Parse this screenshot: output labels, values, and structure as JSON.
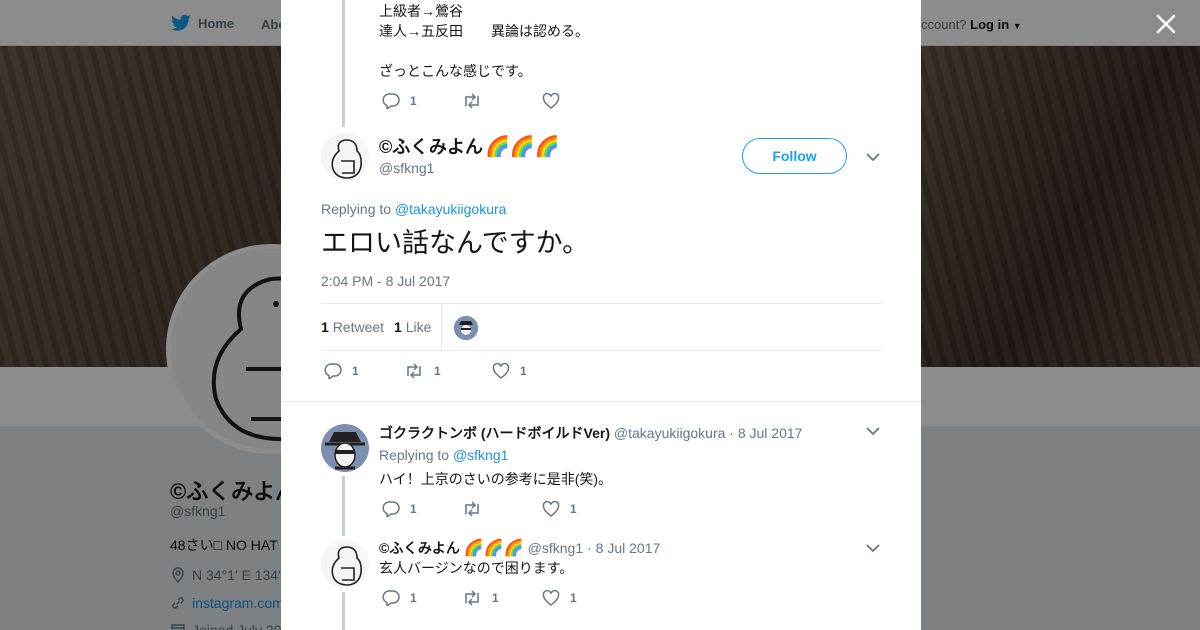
{
  "nav": {
    "home_label": "Home",
    "about_label": "Abo",
    "account_prompt": "ccount?",
    "login_label": "Log in"
  },
  "profile": {
    "name": "©ふくみよん",
    "handle": "@sfkng1",
    "bio": "48さい□ NO HAT",
    "location": "N 34°1′ E 134°",
    "link": "instagram.com",
    "joined": "Joined July 20"
  },
  "prev_tweet": {
    "line1": "上級者→鶯谷",
    "line2": "達人→五反田　　異論は認める。",
    "line3": "ざっとこんな感じです。",
    "reply_count": "1"
  },
  "main_tweet": {
    "author_name": "©ふくみよん",
    "author_emoji": "🌈🌈🌈",
    "author_handle": "@sfkng1",
    "follow_label": "Follow",
    "replying_prefix": "Replying to",
    "replying_to": "@takayukiigokura",
    "text": "エロい話なんですか。",
    "timestamp": "2:04 PM - 8 Jul 2017",
    "retweet_count": "1",
    "retweet_label": "Retweet",
    "like_count": "1",
    "like_label": "Like",
    "reply_count": "1",
    "rt_count": "1",
    "fav_count": "1"
  },
  "replies": [
    {
      "name": "ゴクラクトンボ (ハードボイルドVer)",
      "handle": "@takayukiigokura",
      "date": "· 8 Jul 2017",
      "replying_prefix": "Replying to",
      "replying_to": "@sfkng1",
      "text": "ハイ！上京のさいの参考に是非(笑)。",
      "reply_count": "1",
      "rt_count": "",
      "like_count": "1"
    },
    {
      "name": "©ふくみよん",
      "emoji": "🌈🌈🌈",
      "handle": "@sfkng1",
      "date": "· 8 Jul 2017",
      "text": "玄人バージンなので困ります。",
      "reply_count": "1",
      "rt_count": "1",
      "like_count": "1"
    }
  ],
  "colors": {
    "accent": "#1b95e0",
    "text_secondary": "#657786",
    "thread_line": "#c4cfd6"
  }
}
